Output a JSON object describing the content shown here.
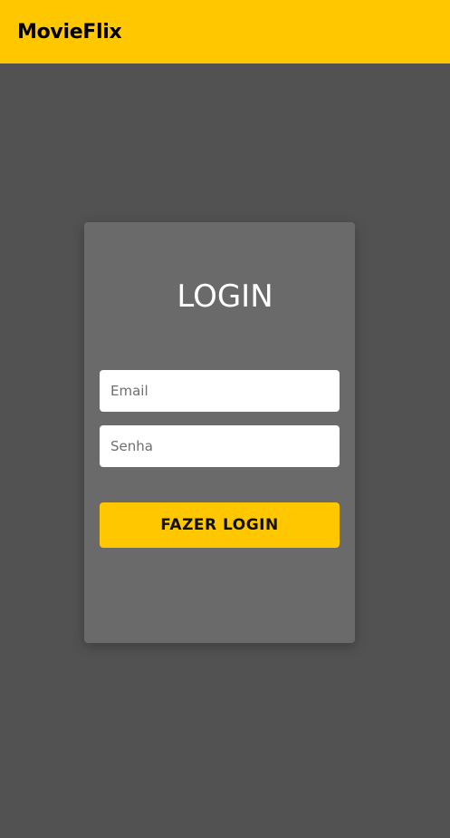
{
  "navbar": {
    "brand": "MovieFlix"
  },
  "login_card": {
    "title": "LOGIN",
    "email_placeholder": "Email",
    "password_placeholder": "Senha",
    "submit_label": "FAZER LOGIN"
  },
  "colors": {
    "accent": "#FFC700",
    "background": "#525252",
    "card": "#6A6A6A"
  }
}
